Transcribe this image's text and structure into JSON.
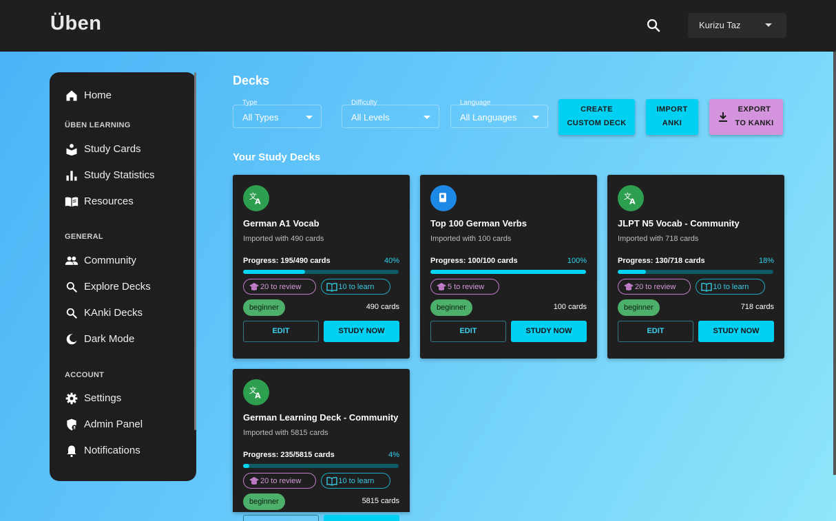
{
  "header": {
    "brand": "Üben",
    "user": "Kurizu Taz"
  },
  "sidebar": {
    "home": "Home",
    "section_learning": "ÜBEN LEARNING",
    "study_cards": "Study Cards",
    "study_statistics": "Study Statistics",
    "resources": "Resources",
    "section_general": "GENERAL",
    "community": "Community",
    "explore_decks": "Explore Decks",
    "kanki_decks": "KAnki Decks",
    "dark_mode": "Dark Mode",
    "section_account": "ACCOUNT",
    "settings": "Settings",
    "admin_panel": "Admin Panel",
    "notifications": "Notifications"
  },
  "main": {
    "title": "Decks",
    "subtitle": "Your Study Decks",
    "filters": {
      "type_label": "Type",
      "type_value": "All Types",
      "difficulty_label": "Difficulty",
      "difficulty_value": "All Levels",
      "language_label": "Language",
      "language_value": "All Languages"
    },
    "buttons": {
      "create_line1": "CREATE",
      "create_line2": "CUSTOM DECK",
      "import_line1": "IMPORT",
      "import_line2": "ANKI",
      "export_line1": "EXPORT",
      "export_line2": "TO KANKI"
    },
    "card_buttons": {
      "edit": "EDIT",
      "study": "STUDY NOW"
    },
    "decks": [
      {
        "title": "German A1 Vocab",
        "imported": "Imported with 490 cards",
        "progress": "Progress: 195/490 cards",
        "pct": "40%",
        "progress_value": 0.4,
        "review": "20 to review",
        "learn": "10 to learn",
        "level": "beginner",
        "cards": "490 cards",
        "icon": "translate-icon",
        "icon_color": "#2e9e4f"
      },
      {
        "title": "Top 100 German Verbs",
        "imported": "Imported with 100 cards",
        "progress": "Progress: 100/100 cards",
        "pct": "100%",
        "progress_value": 1.0,
        "review": "5 to review",
        "learn": "",
        "level": "beginner",
        "cards": "100 cards",
        "icon": "book-icon",
        "icon_color": "#1e88e5"
      },
      {
        "title": "JLPT N5 Vocab - Community",
        "imported": "Imported with 718 cards",
        "progress": "Progress: 130/718 cards",
        "pct": "18%",
        "progress_value": 0.18,
        "review": "20 to review",
        "learn": "10 to learn",
        "level": "beginner",
        "cards": "718 cards",
        "icon": "translate-icon",
        "icon_color": "#2e9e4f"
      },
      {
        "title": "German Learning Deck - Community",
        "imported": "Imported with 5815 cards",
        "progress": "Progress: 235/5815 cards",
        "pct": "4%",
        "progress_value": 0.04,
        "review": "20 to review",
        "learn": "10 to learn",
        "level": "beginner",
        "cards": "5815 cards",
        "icon": "translate-icon",
        "icon_color": "#2e9e4f"
      }
    ]
  }
}
